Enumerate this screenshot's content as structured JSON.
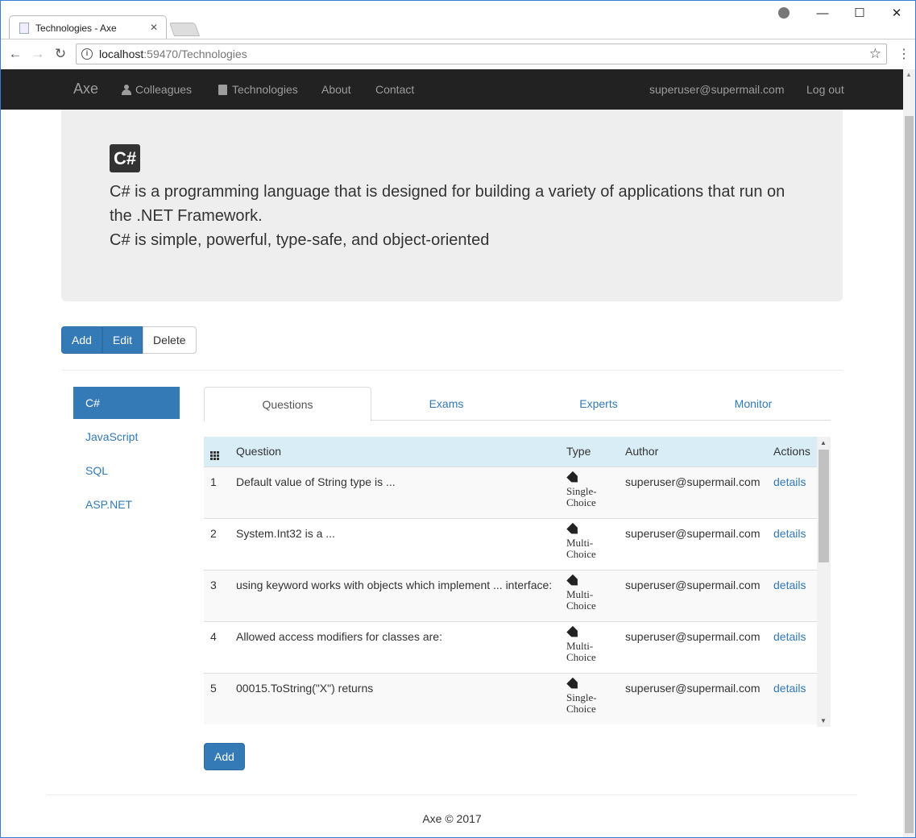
{
  "browser": {
    "tab_title": "Technologies - Axe",
    "url_host": "localhost",
    "url_path": ":59470/Technologies",
    "window_controls": {
      "minimize": "—",
      "maximize": "☐",
      "close": "✕"
    }
  },
  "navbar": {
    "brand": "Axe",
    "links": [
      "Colleagues",
      "Technologies",
      "About",
      "Contact"
    ],
    "user": "superuser@supermail.com",
    "logout": "Log out"
  },
  "jumbotron": {
    "badge": "C#",
    "line1": "C# is a programming language that is designed for building a variety of applications that run on the .NET Framework.",
    "line2": "C# is simple, powerful, type-safe, and object-oriented"
  },
  "actions": {
    "add": "Add",
    "edit": "Edit",
    "delete": "Delete"
  },
  "sidebar": {
    "items": [
      "C#",
      "JavaScript",
      "SQL",
      "ASP.NET"
    ],
    "active": "C#"
  },
  "tabs": {
    "items": [
      "Questions",
      "Exams",
      "Experts",
      "Monitor"
    ],
    "active": "Questions"
  },
  "table": {
    "headers": {
      "question": "Question",
      "type": "Type",
      "author": "Author",
      "actions": "Actions"
    },
    "rows": [
      {
        "num": "1",
        "question": "Default value of String type is ...",
        "type": "Single-Choice",
        "author": "superuser@supermail.com",
        "action": "details"
      },
      {
        "num": "2",
        "question": "System.Int32 is a ...",
        "type": "Multi-Choice",
        "author": "superuser@supermail.com",
        "action": "details"
      },
      {
        "num": "3",
        "question": "using keyword works with objects which implement ... interface:",
        "type": "Multi-Choice",
        "author": "superuser@supermail.com",
        "action": "details"
      },
      {
        "num": "4",
        "question": "Allowed access modifiers for classes are:",
        "type": "Multi-Choice",
        "author": "superuser@supermail.com",
        "action": "details"
      },
      {
        "num": "5",
        "question": "00015.ToString(\"X\") returns",
        "type": "Single-Choice",
        "author": "superuser@supermail.com",
        "action": "details"
      }
    ]
  },
  "add_question_label": "Add",
  "footer": "Axe © 2017",
  "colors": {
    "primary": "#337ab7",
    "navbar": "#222222",
    "jumbotron": "#eeeeee",
    "table_header": "#d9edf7"
  }
}
